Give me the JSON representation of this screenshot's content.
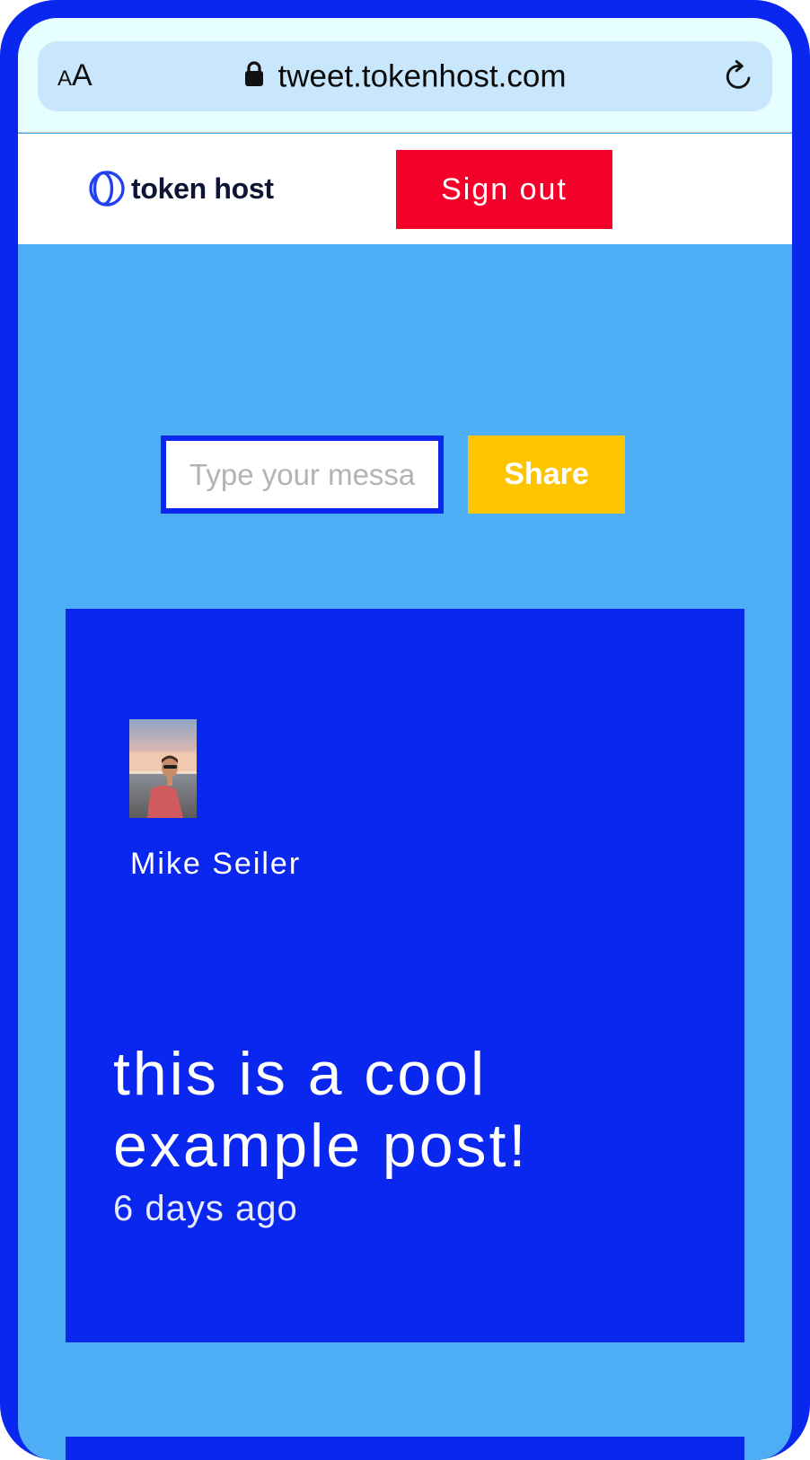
{
  "browser": {
    "text_size_label_small": "A",
    "text_size_label_large": "A",
    "url": "tweet.tokenhost.com",
    "icons": [
      "text-size-icon",
      "lock-icon",
      "reload-icon"
    ]
  },
  "header": {
    "logo_text": "token host",
    "signout_label": "Sign out"
  },
  "compose": {
    "placeholder": "Type your message",
    "value": "",
    "share_label": "Share"
  },
  "posts": [
    {
      "author": "Mike Seiler",
      "text": "this is a cool example post!",
      "time": "6 days ago"
    }
  ],
  "colors": {
    "frame": "#0a27f0",
    "page_bg": "#4dadf5",
    "card_bg": "#0a27f0",
    "signout": "#f5002b",
    "share": "#fdc400",
    "url_bar": "#c8e6fc",
    "chrome_bg": "#e6fefe"
  }
}
